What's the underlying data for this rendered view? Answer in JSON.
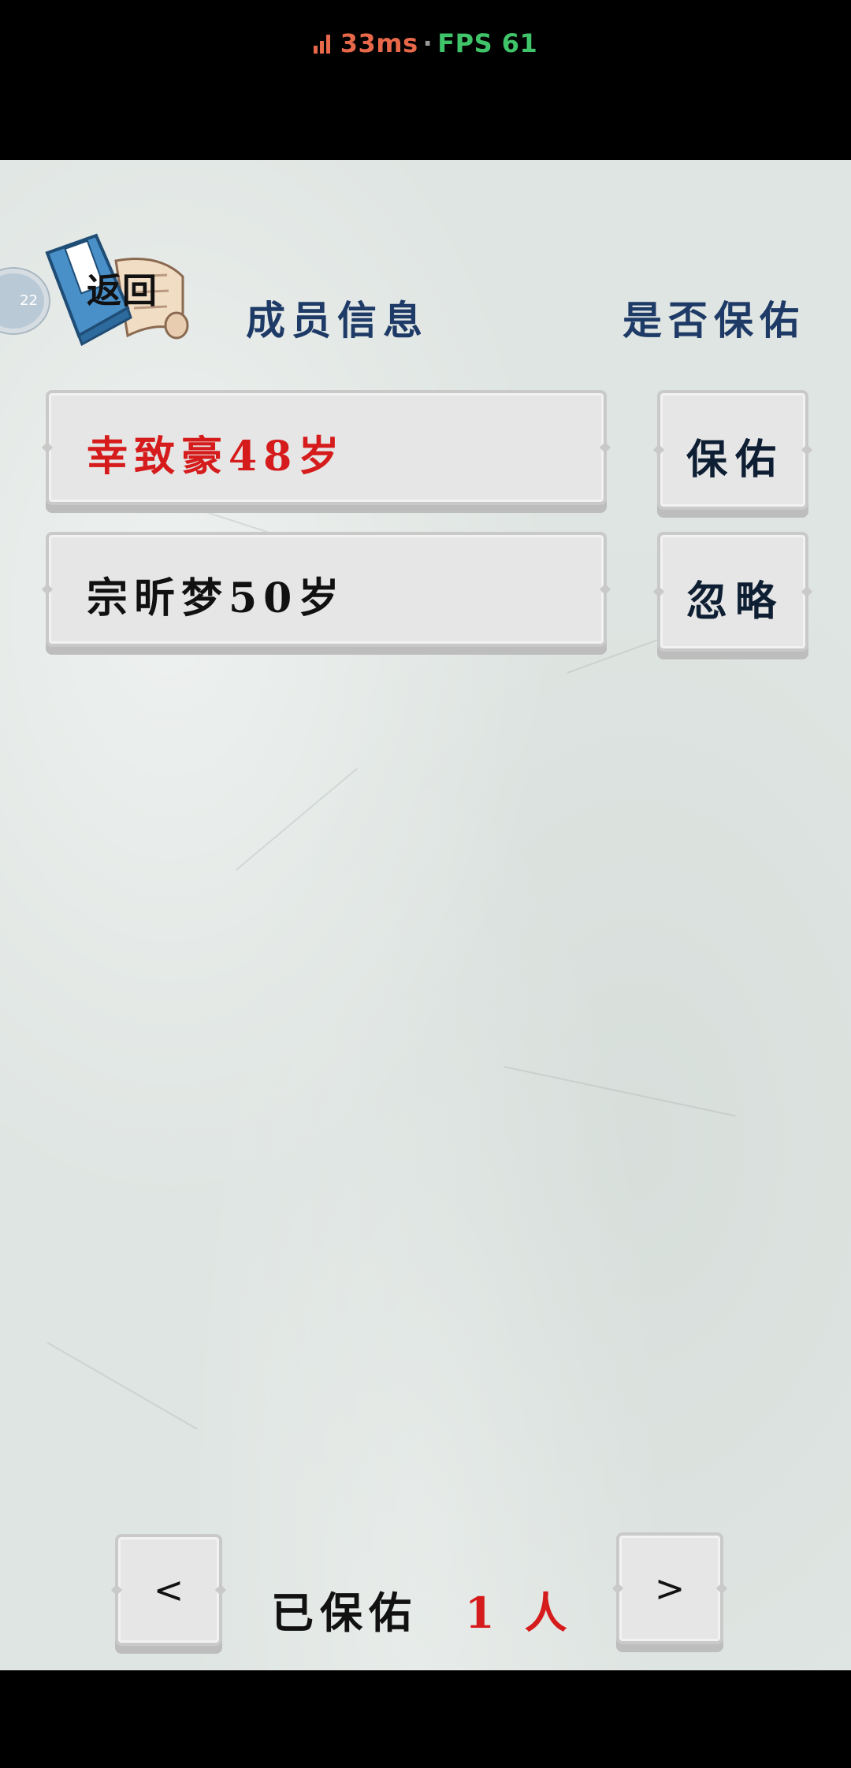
{
  "status": {
    "latency": "33ms",
    "separator": "·",
    "fps": "FPS 61"
  },
  "side_bubble": {
    "text": "22"
  },
  "back": {
    "label": "返回",
    "icon": "book-scroll-icon"
  },
  "headers": {
    "members": "成员信息",
    "bless": "是否保佑"
  },
  "members": [
    {
      "name": "幸致豪48岁",
      "color": "#d51b1b",
      "action": "保佑"
    },
    {
      "name": "宗昕梦50岁",
      "color": "#111111",
      "action": "忽略"
    }
  ],
  "pagination": {
    "prev": "<",
    "next": ">"
  },
  "summary": {
    "label": "已保佑",
    "count": "1",
    "unit": "人"
  },
  "colors": {
    "header": "#1e3a66",
    "highlight": "#d51b1b",
    "background": "#dfe5e2"
  }
}
